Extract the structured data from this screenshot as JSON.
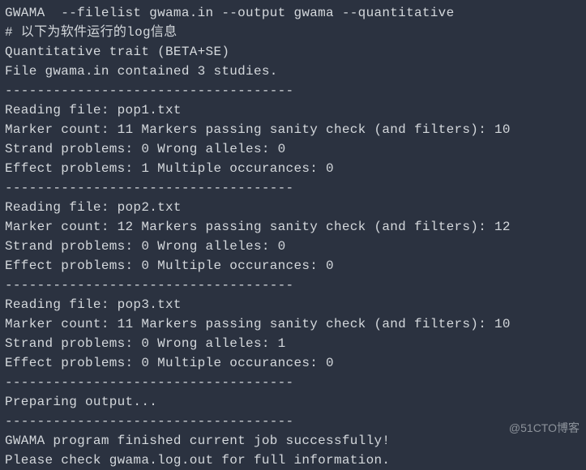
{
  "terminal": {
    "lines": [
      "GWAMA  --filelist gwama.in --output gwama --quantitative",
      "# 以下为软件运行的log信息",
      "Quantitative trait (BETA+SE)",
      "File gwama.in contained 3 studies.",
      "------------------------------------",
      "Reading file: pop1.txt",
      "Marker count: 11 Markers passing sanity check (and filters): 10",
      "Strand problems: 0 Wrong alleles: 0",
      "Effect problems: 1 Multiple occurances: 0",
      "------------------------------------",
      "Reading file: pop2.txt",
      "Marker count: 12 Markers passing sanity check (and filters): 12",
      "Strand problems: 0 Wrong alleles: 0",
      "Effect problems: 0 Multiple occurances: 0",
      "------------------------------------",
      "Reading file: pop3.txt",
      "Marker count: 11 Markers passing sanity check (and filters): 10",
      "Strand problems: 0 Wrong alleles: 1",
      "Effect problems: 0 Multiple occurances: 0",
      "------------------------------------",
      "Preparing output...",
      "------------------------------------",
      "GWAMA program finished current job successfully!",
      "Please check gwama.log.out for full information."
    ]
  },
  "watermark": "@51CTO博客"
}
